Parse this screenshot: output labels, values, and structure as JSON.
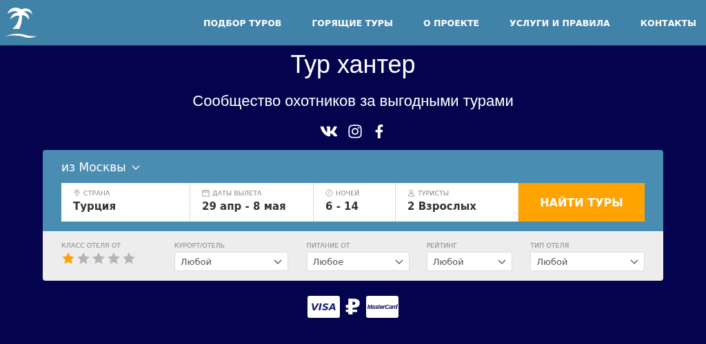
{
  "nav": [
    {
      "label": "ПОДБОР ТУРОВ"
    },
    {
      "label": "ГОРЯЩИЕ ТУРЫ"
    },
    {
      "label": "О ПРОЕКТЕ"
    },
    {
      "label": "УСЛУГИ И ПРАВИЛА"
    },
    {
      "label": "КОНТАКТЫ"
    }
  ],
  "hero": {
    "title": "Тур хантер",
    "subtitle": "Сообщество охотников за выгодными турами"
  },
  "search": {
    "departure": "из Москвы",
    "fields": [
      {
        "kind": "pin",
        "label": "СТРАНА",
        "value": "Турция"
      },
      {
        "kind": "calendar",
        "label": "ДАТЫ ВЫЛЕТА",
        "value": "29 апр - 8 мая"
      },
      {
        "kind": "clock",
        "label": "НОЧЕЙ",
        "value": "6 - 14"
      },
      {
        "kind": "person",
        "label": "ТУРИСТЫ",
        "value": "2 Взрослых"
      }
    ],
    "button": "НАЙТИ ТУРЫ",
    "hotel_class": {
      "label": "КЛАСС ОТЕЛЯ ОТ",
      "stars": 1
    },
    "filters": [
      {
        "label": "КУРОРТ/ОТЕЛЬ",
        "value": "Любой"
      },
      {
        "label": "ПИТАНИЕ ОТ",
        "value": "Любое"
      },
      {
        "label": "РЕЙТИНГ",
        "value": "Любой"
      },
      {
        "label": "ТИП ОТЕЛЯ",
        "value": "Любой"
      }
    ]
  },
  "payments": {
    "visa": "VISA",
    "ruble": "₽",
    "mastercard": "MasterCard"
  }
}
